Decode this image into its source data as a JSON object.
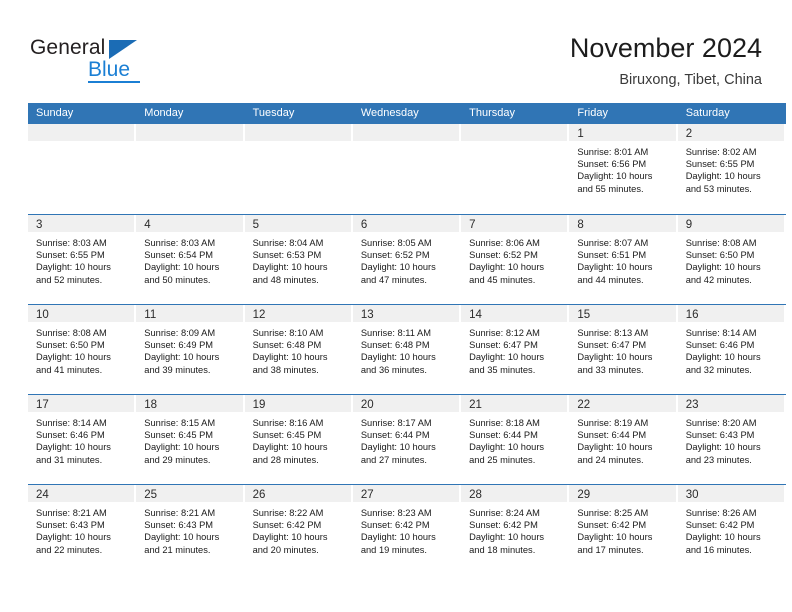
{
  "brand": {
    "name_part1": "General",
    "name_part2": "Blue",
    "triangle_color": "#1b6cb5",
    "blue_color": "#1b7fd4"
  },
  "header": {
    "title": "November 2024",
    "location": "Biruxong, Tibet, China"
  },
  "colors": {
    "header_blue": "#3075b5",
    "date_band_gray": "#f0f0f0",
    "text": "#1a1a1a"
  },
  "weekdays": [
    "Sunday",
    "Monday",
    "Tuesday",
    "Wednesday",
    "Thursday",
    "Friday",
    "Saturday"
  ],
  "weeks": [
    [
      {
        "day": "",
        "sunrise": "",
        "sunset": "",
        "daylight1": "",
        "daylight2": ""
      },
      {
        "day": "",
        "sunrise": "",
        "sunset": "",
        "daylight1": "",
        "daylight2": ""
      },
      {
        "day": "",
        "sunrise": "",
        "sunset": "",
        "daylight1": "",
        "daylight2": ""
      },
      {
        "day": "",
        "sunrise": "",
        "sunset": "",
        "daylight1": "",
        "daylight2": ""
      },
      {
        "day": "",
        "sunrise": "",
        "sunset": "",
        "daylight1": "",
        "daylight2": ""
      },
      {
        "day": "1",
        "sunrise": "Sunrise: 8:01 AM",
        "sunset": "Sunset: 6:56 PM",
        "daylight1": "Daylight: 10 hours",
        "daylight2": "and 55 minutes."
      },
      {
        "day": "2",
        "sunrise": "Sunrise: 8:02 AM",
        "sunset": "Sunset: 6:55 PM",
        "daylight1": "Daylight: 10 hours",
        "daylight2": "and 53 minutes."
      }
    ],
    [
      {
        "day": "3",
        "sunrise": "Sunrise: 8:03 AM",
        "sunset": "Sunset: 6:55 PM",
        "daylight1": "Daylight: 10 hours",
        "daylight2": "and 52 minutes."
      },
      {
        "day": "4",
        "sunrise": "Sunrise: 8:03 AM",
        "sunset": "Sunset: 6:54 PM",
        "daylight1": "Daylight: 10 hours",
        "daylight2": "and 50 minutes."
      },
      {
        "day": "5",
        "sunrise": "Sunrise: 8:04 AM",
        "sunset": "Sunset: 6:53 PM",
        "daylight1": "Daylight: 10 hours",
        "daylight2": "and 48 minutes."
      },
      {
        "day": "6",
        "sunrise": "Sunrise: 8:05 AM",
        "sunset": "Sunset: 6:52 PM",
        "daylight1": "Daylight: 10 hours",
        "daylight2": "and 47 minutes."
      },
      {
        "day": "7",
        "sunrise": "Sunrise: 8:06 AM",
        "sunset": "Sunset: 6:52 PM",
        "daylight1": "Daylight: 10 hours",
        "daylight2": "and 45 minutes."
      },
      {
        "day": "8",
        "sunrise": "Sunrise: 8:07 AM",
        "sunset": "Sunset: 6:51 PM",
        "daylight1": "Daylight: 10 hours",
        "daylight2": "and 44 minutes."
      },
      {
        "day": "9",
        "sunrise": "Sunrise: 8:08 AM",
        "sunset": "Sunset: 6:50 PM",
        "daylight1": "Daylight: 10 hours",
        "daylight2": "and 42 minutes."
      }
    ],
    [
      {
        "day": "10",
        "sunrise": "Sunrise: 8:08 AM",
        "sunset": "Sunset: 6:50 PM",
        "daylight1": "Daylight: 10 hours",
        "daylight2": "and 41 minutes."
      },
      {
        "day": "11",
        "sunrise": "Sunrise: 8:09 AM",
        "sunset": "Sunset: 6:49 PM",
        "daylight1": "Daylight: 10 hours",
        "daylight2": "and 39 minutes."
      },
      {
        "day": "12",
        "sunrise": "Sunrise: 8:10 AM",
        "sunset": "Sunset: 6:48 PM",
        "daylight1": "Daylight: 10 hours",
        "daylight2": "and 38 minutes."
      },
      {
        "day": "13",
        "sunrise": "Sunrise: 8:11 AM",
        "sunset": "Sunset: 6:48 PM",
        "daylight1": "Daylight: 10 hours",
        "daylight2": "and 36 minutes."
      },
      {
        "day": "14",
        "sunrise": "Sunrise: 8:12 AM",
        "sunset": "Sunset: 6:47 PM",
        "daylight1": "Daylight: 10 hours",
        "daylight2": "and 35 minutes."
      },
      {
        "day": "15",
        "sunrise": "Sunrise: 8:13 AM",
        "sunset": "Sunset: 6:47 PM",
        "daylight1": "Daylight: 10 hours",
        "daylight2": "and 33 minutes."
      },
      {
        "day": "16",
        "sunrise": "Sunrise: 8:14 AM",
        "sunset": "Sunset: 6:46 PM",
        "daylight1": "Daylight: 10 hours",
        "daylight2": "and 32 minutes."
      }
    ],
    [
      {
        "day": "17",
        "sunrise": "Sunrise: 8:14 AM",
        "sunset": "Sunset: 6:46 PM",
        "daylight1": "Daylight: 10 hours",
        "daylight2": "and 31 minutes."
      },
      {
        "day": "18",
        "sunrise": "Sunrise: 8:15 AM",
        "sunset": "Sunset: 6:45 PM",
        "daylight1": "Daylight: 10 hours",
        "daylight2": "and 29 minutes."
      },
      {
        "day": "19",
        "sunrise": "Sunrise: 8:16 AM",
        "sunset": "Sunset: 6:45 PM",
        "daylight1": "Daylight: 10 hours",
        "daylight2": "and 28 minutes."
      },
      {
        "day": "20",
        "sunrise": "Sunrise: 8:17 AM",
        "sunset": "Sunset: 6:44 PM",
        "daylight1": "Daylight: 10 hours",
        "daylight2": "and 27 minutes."
      },
      {
        "day": "21",
        "sunrise": "Sunrise: 8:18 AM",
        "sunset": "Sunset: 6:44 PM",
        "daylight1": "Daylight: 10 hours",
        "daylight2": "and 25 minutes."
      },
      {
        "day": "22",
        "sunrise": "Sunrise: 8:19 AM",
        "sunset": "Sunset: 6:44 PM",
        "daylight1": "Daylight: 10 hours",
        "daylight2": "and 24 minutes."
      },
      {
        "day": "23",
        "sunrise": "Sunrise: 8:20 AM",
        "sunset": "Sunset: 6:43 PM",
        "daylight1": "Daylight: 10 hours",
        "daylight2": "and 23 minutes."
      }
    ],
    [
      {
        "day": "24",
        "sunrise": "Sunrise: 8:21 AM",
        "sunset": "Sunset: 6:43 PM",
        "daylight1": "Daylight: 10 hours",
        "daylight2": "and 22 minutes."
      },
      {
        "day": "25",
        "sunrise": "Sunrise: 8:21 AM",
        "sunset": "Sunset: 6:43 PM",
        "daylight1": "Daylight: 10 hours",
        "daylight2": "and 21 minutes."
      },
      {
        "day": "26",
        "sunrise": "Sunrise: 8:22 AM",
        "sunset": "Sunset: 6:42 PM",
        "daylight1": "Daylight: 10 hours",
        "daylight2": "and 20 minutes."
      },
      {
        "day": "27",
        "sunrise": "Sunrise: 8:23 AM",
        "sunset": "Sunset: 6:42 PM",
        "daylight1": "Daylight: 10 hours",
        "daylight2": "and 19 minutes."
      },
      {
        "day": "28",
        "sunrise": "Sunrise: 8:24 AM",
        "sunset": "Sunset: 6:42 PM",
        "daylight1": "Daylight: 10 hours",
        "daylight2": "and 18 minutes."
      },
      {
        "day": "29",
        "sunrise": "Sunrise: 8:25 AM",
        "sunset": "Sunset: 6:42 PM",
        "daylight1": "Daylight: 10 hours",
        "daylight2": "and 17 minutes."
      },
      {
        "day": "30",
        "sunrise": "Sunrise: 8:26 AM",
        "sunset": "Sunset: 6:42 PM",
        "daylight1": "Daylight: 10 hours",
        "daylight2": "and 16 minutes."
      }
    ]
  ]
}
